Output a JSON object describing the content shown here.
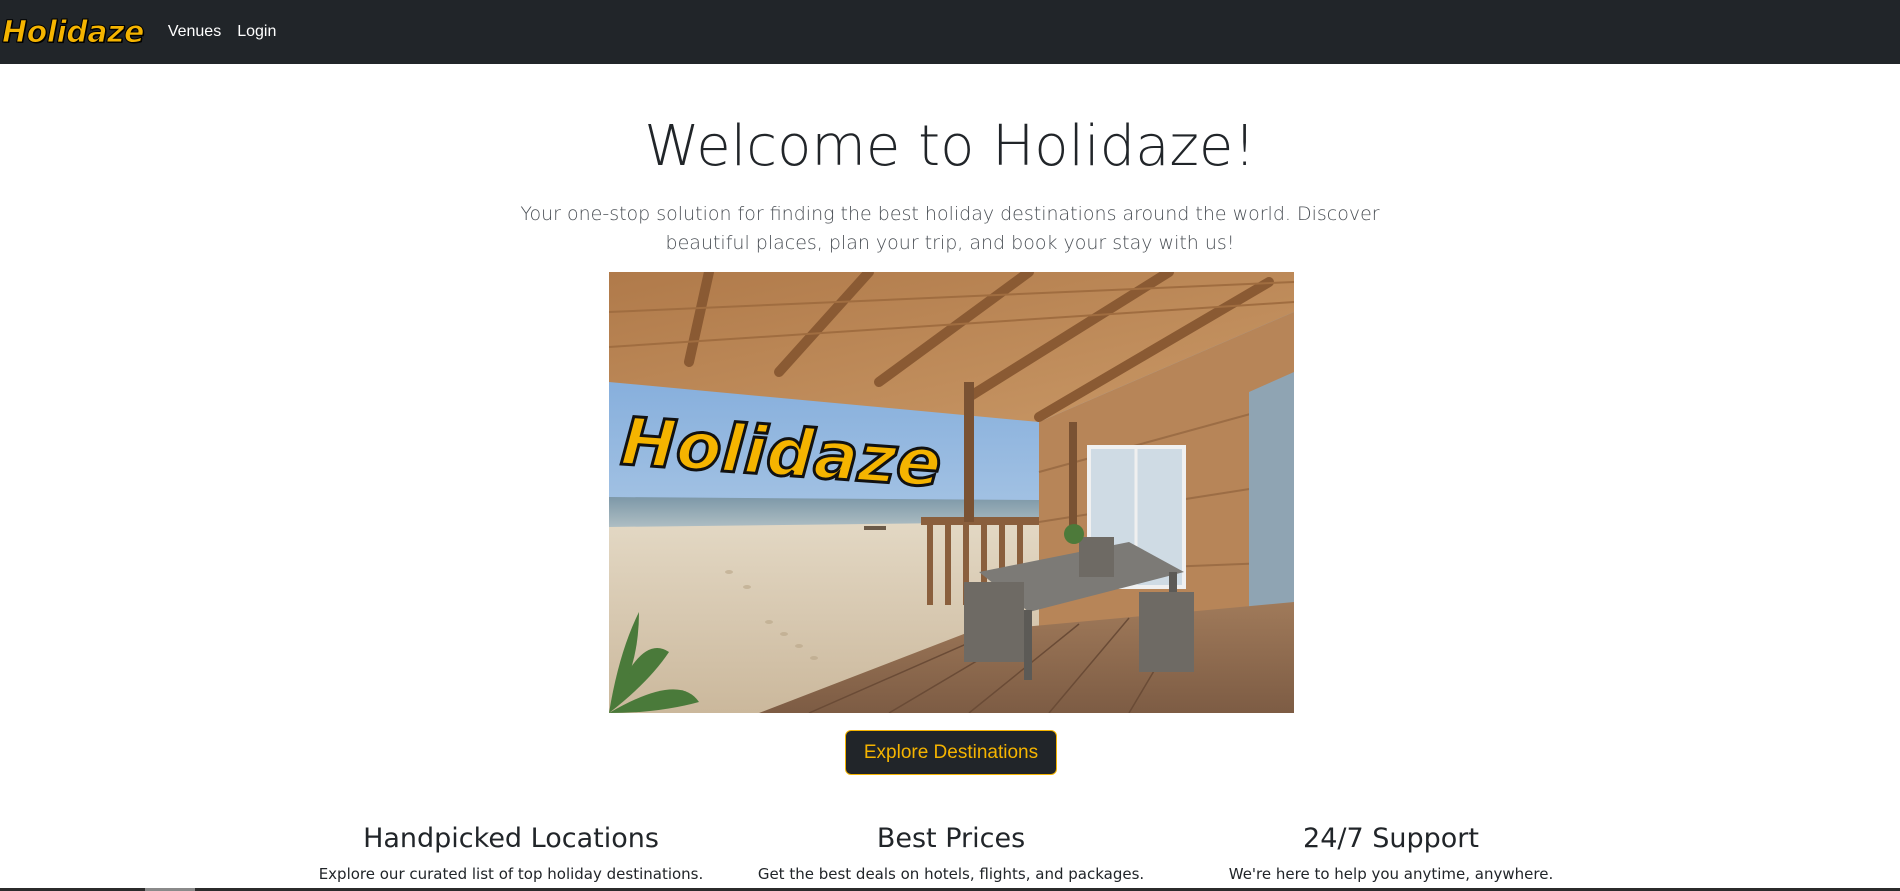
{
  "navbar": {
    "brand": "Holidaze",
    "links": [
      {
        "label": "Venues"
      },
      {
        "label": "Login"
      }
    ]
  },
  "hero": {
    "title": "Welcome to Holidaze!",
    "lead": "Your one-stop solution for finding the best holiday destinations around the world. Discover beautiful places, plan your trip, and book your stay with us!",
    "image_logo_text": "Holidaze",
    "cta_label": "Explore Destinations"
  },
  "features": [
    {
      "title": "Handpicked Locations",
      "text": "Explore our curated list of top holiday destinations."
    },
    {
      "title": "Best Prices",
      "text": "Get the best deals on hotels, flights, and packages."
    },
    {
      "title": "24/7 Support",
      "text": "We're here to help you anytime, anywhere."
    }
  ],
  "colors": {
    "navbar_bg": "#212529",
    "accent": "#f5b400",
    "text": "#212529"
  }
}
